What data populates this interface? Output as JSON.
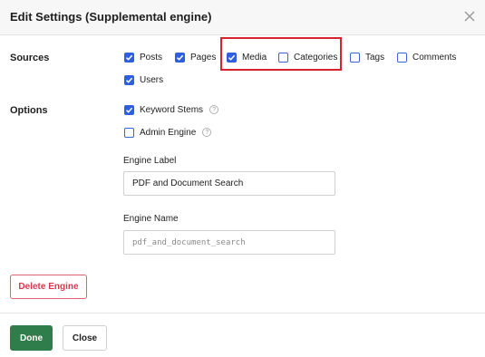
{
  "dialog": {
    "title": "Edit Settings (Supplemental engine)"
  },
  "sources": {
    "label": "Sources",
    "items": [
      {
        "label": "Posts",
        "checked": true
      },
      {
        "label": "Pages",
        "checked": true
      },
      {
        "label": "Media",
        "checked": true
      },
      {
        "label": "Categories",
        "checked": false
      },
      {
        "label": "Tags",
        "checked": false
      },
      {
        "label": "Comments",
        "checked": false
      },
      {
        "label": "Users",
        "checked": true
      }
    ]
  },
  "options": {
    "label": "Options",
    "keyword_stems": {
      "label": "Keyword Stems",
      "checked": true
    },
    "admin_engine": {
      "label": "Admin Engine",
      "checked": false
    },
    "help_glyph": "?",
    "engine_label": {
      "label": "Engine Label",
      "value": "PDF and Document Search"
    },
    "engine_name": {
      "label": "Engine Name",
      "value": "pdf_and_document_search"
    }
  },
  "actions": {
    "delete_label": "Delete Engine",
    "done_label": "Done",
    "close_label": "Close"
  },
  "colors": {
    "checkbox_accent": "#2f5fdc",
    "highlight": "#d8232f",
    "done": "#2e7d4a",
    "delete": "#d63a4e"
  }
}
